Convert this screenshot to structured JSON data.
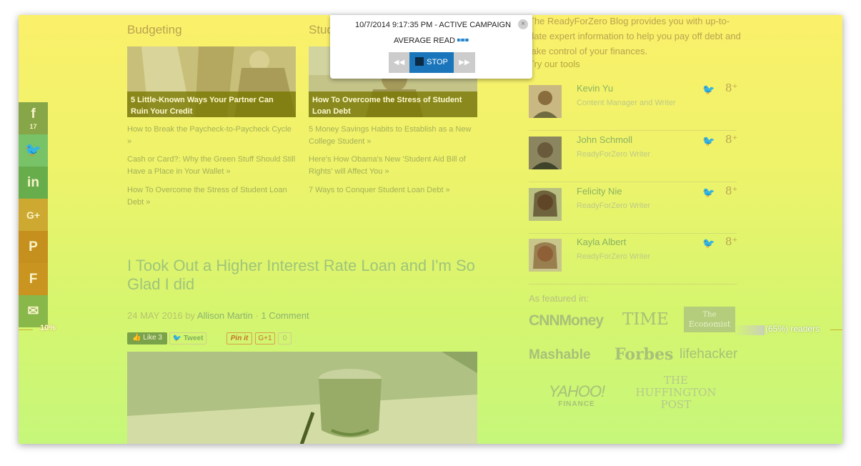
{
  "popup": {
    "line1": "10/7/2014 9:17:35 PM - ACTIVE CAMPAIGN",
    "line2": "AVERAGE READ",
    "close_glyph": "×",
    "prev_glyph": "◀◀",
    "stop_label": "STOP",
    "next_glyph": "▶▶"
  },
  "sections": [
    {
      "title": "Budgeting",
      "card_caption": "5 Little-Known Ways Your Partner Can Ruin Your Credit",
      "links": [
        "How to Break the Paycheck-to-Paycheck Cycle »",
        "Cash or Card?: Why the Green Stuff Should Still Have a Place in Your Wallet »",
        "How To Overcome the Stress of Student Loan Debt »"
      ]
    },
    {
      "title": "Stud",
      "card_caption": "How To Overcome the Stress of Student Loan Debt",
      "links": [
        "5 Money Savings Habits to Establish as a New College Student »",
        "Here's How Obama's New 'Student Aid Bill of Rights' will Affect You »",
        "7 Ways to Conquer Student Loan Debt »"
      ]
    }
  ],
  "post": {
    "title": "I Took Out a Higher Interest Rate Loan and I'm So Glad I did",
    "date": "24 MAY 2016",
    "by": "by",
    "author": "Allison Martin",
    "sep": "·",
    "comments": "1 Comment",
    "like_label": "Like 3",
    "tweet_label": "Tweet",
    "pinit_label": "Pin it",
    "gplus_label": "G+1",
    "gplus_count": "0"
  },
  "share_bar": [
    {
      "name": "facebook",
      "glyph": "f",
      "count": "17",
      "color": "#86a648"
    },
    {
      "name": "twitter",
      "glyph": "🐦",
      "color": "#78c268"
    },
    {
      "name": "linkedin",
      "glyph": "in",
      "color": "#68ad4c"
    },
    {
      "name": "google-plus",
      "glyph": "G+",
      "color": "#cea932"
    },
    {
      "name": "pinterest",
      "glyph": "P",
      "color": "#c6901e"
    },
    {
      "name": "flipboard",
      "glyph": "F",
      "color": "#c99420"
    },
    {
      "name": "email",
      "glyph": "✉",
      "color": "#88b74a"
    }
  ],
  "scroll_left_percent": "10%",
  "readers_label": "(65%) readers",
  "sidebar": {
    "intro": "The ReadyForZero Blog provides you with up-to-date expert information to help you pay off debt and take control of your finances.",
    "tools_link": "Try our tools",
    "authors": [
      {
        "name": "Kevin Yu",
        "role": "Content Manager and Writer"
      },
      {
        "name": "John Schmoll",
        "role": "ReadyForZero Writer"
      },
      {
        "name": "Felicity Nie",
        "role": "ReadyForZero Writer"
      },
      {
        "name": "Kayla Albert",
        "role": "ReadyForZero Writer"
      }
    ],
    "tw_glyph": "🐦",
    "gp_glyph": "8⁺",
    "featured_label": "As featured in:",
    "logos": {
      "cnn": "CNNMoney",
      "time": "TIME",
      "economist_1": "The",
      "economist_2": "Economist",
      "mashable": "Mashable",
      "forbes": "Forbes",
      "lifehacker": "lifehacker",
      "yahoo": "YAHOO!",
      "yahoo_sub": "FINANCE",
      "huff_1": "THE",
      "huff_2": "HUFFINGTON",
      "huff_3": "POST"
    }
  },
  "colors": {
    "accent": "#8ab261",
    "overlay_top": "#fbf06a",
    "overlay_bottom": "#c6f77a",
    "stop_button": "#1a75bb"
  }
}
